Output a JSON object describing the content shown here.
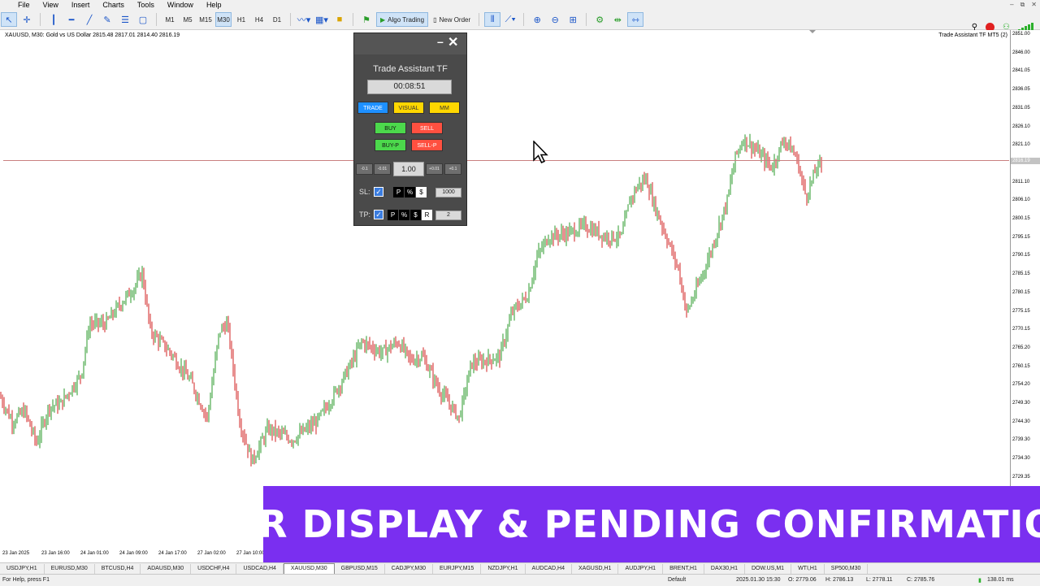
{
  "menubar": [
    "File",
    "View",
    "Insert",
    "Charts",
    "Tools",
    "Window",
    "Help"
  ],
  "toolbar": {
    "timeframes": [
      "M1",
      "M5",
      "M15",
      "M30",
      "H1",
      "H4",
      "D1"
    ],
    "active_timeframe": "M30",
    "algo_trading_label": "Algo Trading",
    "new_order_label": "New Order"
  },
  "chart": {
    "info": "XAUUSD, M30: Gold vs US Dollar 2815.48 2817.01 2814.40 2816.19",
    "ea_name": "Trade Assistant TF MT5 (2)",
    "current_price": "2816.19",
    "price_ticks": [
      "2851.00",
      "2846.00",
      "2841.05",
      "2836.05",
      "2831.05",
      "2826.10",
      "2821.10",
      "2816.19",
      "2811.10",
      "2806.10",
      "2800.15",
      "2795.15",
      "2790.15",
      "2785.15",
      "2780.15",
      "2775.15",
      "2770.15",
      "2765.20",
      "2760.15",
      "2754.20",
      "2749.30",
      "2744.30",
      "2739.30",
      "2734.30",
      "2729.35"
    ],
    "time_ticks": [
      "23 Jan 2025",
      "23 Jan 16:00",
      "24 Jan 01:00",
      "24 Jan 09:00",
      "24 Jan 17:00",
      "27 Jan 02:00",
      "27 Jan 10:00"
    ]
  },
  "chart_data": {
    "type": "candlestick",
    "title": "XAUUSD, M30: Gold vs US Dollar",
    "last_ohlc": {
      "open": 2815.48,
      "high": 2817.01,
      "low": 2814.4,
      "close": 2816.19
    },
    "ylim": [
      2727,
      2853
    ],
    "trend_points": [
      [
        0,
        2752
      ],
      [
        15,
        2745
      ],
      [
        30,
        2748
      ],
      [
        45,
        2739
      ],
      [
        60,
        2749
      ],
      [
        75,
        2750
      ],
      [
        100,
        2758
      ],
      [
        110,
        2772
      ],
      [
        130,
        2772
      ],
      [
        150,
        2778
      ],
      [
        165,
        2782
      ],
      [
        175,
        2786
      ],
      [
        185,
        2770
      ],
      [
        210,
        2764
      ],
      [
        235,
        2756
      ],
      [
        255,
        2746
      ],
      [
        270,
        2770
      ],
      [
        280,
        2772
      ],
      [
        295,
        2745
      ],
      [
        310,
        2734
      ],
      [
        330,
        2743
      ],
      [
        360,
        2740
      ],
      [
        390,
        2745
      ],
      [
        410,
        2752
      ],
      [
        430,
        2760
      ],
      [
        445,
        2767
      ],
      [
        470,
        2764
      ],
      [
        490,
        2767
      ],
      [
        505,
        2762
      ],
      [
        520,
        2763
      ],
      [
        540,
        2754
      ],
      [
        565,
        2746
      ],
      [
        580,
        2761
      ],
      [
        600,
        2762
      ],
      [
        615,
        2763
      ],
      [
        630,
        2775
      ],
      [
        650,
        2780
      ],
      [
        660,
        2790
      ],
      [
        675,
        2796
      ],
      [
        700,
        2797
      ],
      [
        720,
        2799
      ],
      [
        745,
        2796
      ],
      [
        765,
        2796
      ],
      [
        775,
        2806
      ],
      [
        785,
        2810
      ],
      [
        795,
        2812
      ],
      [
        805,
        2805
      ],
      [
        820,
        2796
      ],
      [
        835,
        2787
      ],
      [
        845,
        2775
      ],
      [
        860,
        2783
      ],
      [
        875,
        2792
      ],
      [
        895,
        2806
      ],
      [
        905,
        2818
      ],
      [
        915,
        2823
      ],
      [
        930,
        2820
      ],
      [
        950,
        2815
      ],
      [
        965,
        2823
      ],
      [
        980,
        2818
      ],
      [
        992,
        2807
      ],
      [
        1005,
        2815
      ],
      [
        1012,
        2816
      ]
    ]
  },
  "panel": {
    "title": "Trade Assistant TF",
    "timer": "00:08:51",
    "tabs": {
      "trade": "TRADE",
      "visual": "VISUAL",
      "mm": "MM"
    },
    "buy": "BUY",
    "sell": "SELL",
    "buy_p": "BUY-P",
    "sell_p": "SELL-P",
    "lot_minus_big": "-0.1",
    "lot_minus_small": "-0.01",
    "lot": "1.00",
    "lot_plus_small": "+0.01",
    "lot_plus_big": "+0.1",
    "sl_label": "SL:",
    "tp_label": "TP:",
    "sl_value": "1000",
    "tp_value": "2",
    "mode_p": "P",
    "mode_pct": "%",
    "mode_usd": "$",
    "mode_r": "R",
    "colors": {
      "trade": "#1e90ff",
      "visual": "#ffd700",
      "mm": "#ffd700",
      "buy": "#4cd94c",
      "sell": "#ff5040"
    }
  },
  "banner": {
    "text": "R/R DISPLAY & PENDING CONFIRMATION",
    "color": "#7a2ff0"
  },
  "symbol_tabs": [
    "USDJPY,H1",
    "EURUSD,M30",
    "BTCUSD,H4",
    "ADAUSD,M30",
    "USDCHF,H4",
    "USDCAD,H4",
    "XAUUSD,M30",
    "GBPUSD,M15",
    "CADJPY,M30",
    "EURJPY,M15",
    "NZDJPY,H1",
    "AUDCAD,H4",
    "XAGUSD,H1",
    "AUDJPY,H1",
    "BRENT,H1",
    "DAX30,H1",
    "DOW.US,M1",
    "WTI,H1",
    "SP500,M30"
  ],
  "active_symbol_tab": "XAUUSD,M30",
  "status": {
    "help": "For Help, press F1",
    "profile": "Default",
    "datetime": "2025.01.30 15:30",
    "open": "O: 2779.06",
    "high": "H: 2786.13",
    "low": "L: 2778.11",
    "close": "C: 2785.76",
    "traffic": "138.01 ms"
  }
}
